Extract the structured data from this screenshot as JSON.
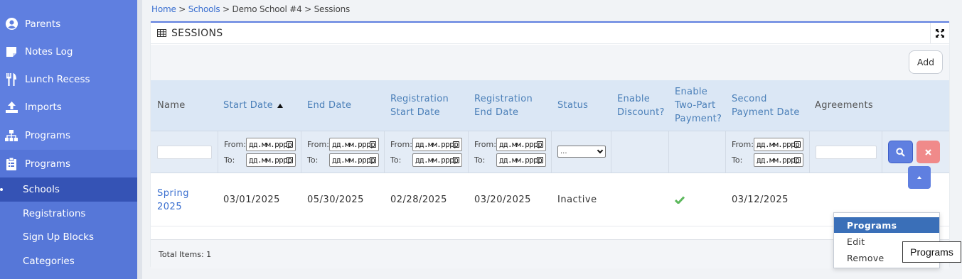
{
  "sidebar": {
    "items": [
      {
        "label": "Parents",
        "icon": "user-circle-icon"
      },
      {
        "label": "Notes Log",
        "icon": "note-icon"
      },
      {
        "label": "Lunch Recess",
        "icon": "utensils-icon"
      },
      {
        "label": "Imports",
        "icon": "upload-icon"
      },
      {
        "label": "Programs",
        "icon": "sitemap-icon"
      },
      {
        "label": "Programs",
        "icon": "clipboard-icon"
      }
    ],
    "sub_items": [
      {
        "label": "Schools"
      },
      {
        "label": "Registrations"
      },
      {
        "label": "Sign Up Blocks"
      },
      {
        "label": "Categories"
      }
    ]
  },
  "breadcrumb": {
    "home": "Home",
    "sep1": " > ",
    "schools": "Schools",
    "sep2": " > ",
    "school": "Demo School #4",
    "sep3": " > ",
    "current": "Sessions"
  },
  "panel": {
    "title": "SESSIONS",
    "add_label": "Add"
  },
  "table": {
    "columns": [
      {
        "label": "Name"
      },
      {
        "label": "Start Date"
      },
      {
        "label": "End Date"
      },
      {
        "label": "Registration Start Date"
      },
      {
        "label": "Registration End Date"
      },
      {
        "label": "Status"
      },
      {
        "label": "Enable Discount?"
      },
      {
        "label": "Enable Two-Part Payment?"
      },
      {
        "label": "Second Payment Date"
      },
      {
        "label": "Agreements"
      }
    ],
    "filters": {
      "from_label": "From:",
      "to_label": "To:",
      "date_placeholder": "дд.мм.рррр",
      "status_value": "..."
    },
    "rows": [
      {
        "name": "Spring 2025",
        "start_date": "03/01/2025",
        "end_date": "05/30/2025",
        "reg_start": "02/28/2025",
        "reg_end": "03/20/2025",
        "status": "Inactive",
        "enable_discount": "",
        "two_part_payment": "check-icon",
        "second_payment_date": "03/12/2025",
        "agreements": ""
      }
    ],
    "total_items": "Total Items: 1"
  },
  "menu": {
    "items": [
      {
        "label": "Programs",
        "active": true
      },
      {
        "label": "Edit"
      },
      {
        "label": "Remove"
      }
    ],
    "tooltip": "Programs"
  },
  "colors": {
    "sidebar": "#5f7fe0",
    "sidebar_current": "#3553b5",
    "header_bg": "#dbe7f5",
    "header_text": "#4a7fb8",
    "menu_active": "#3a6fb8",
    "danger": "#f08a8a",
    "check": "#5cb85c"
  }
}
